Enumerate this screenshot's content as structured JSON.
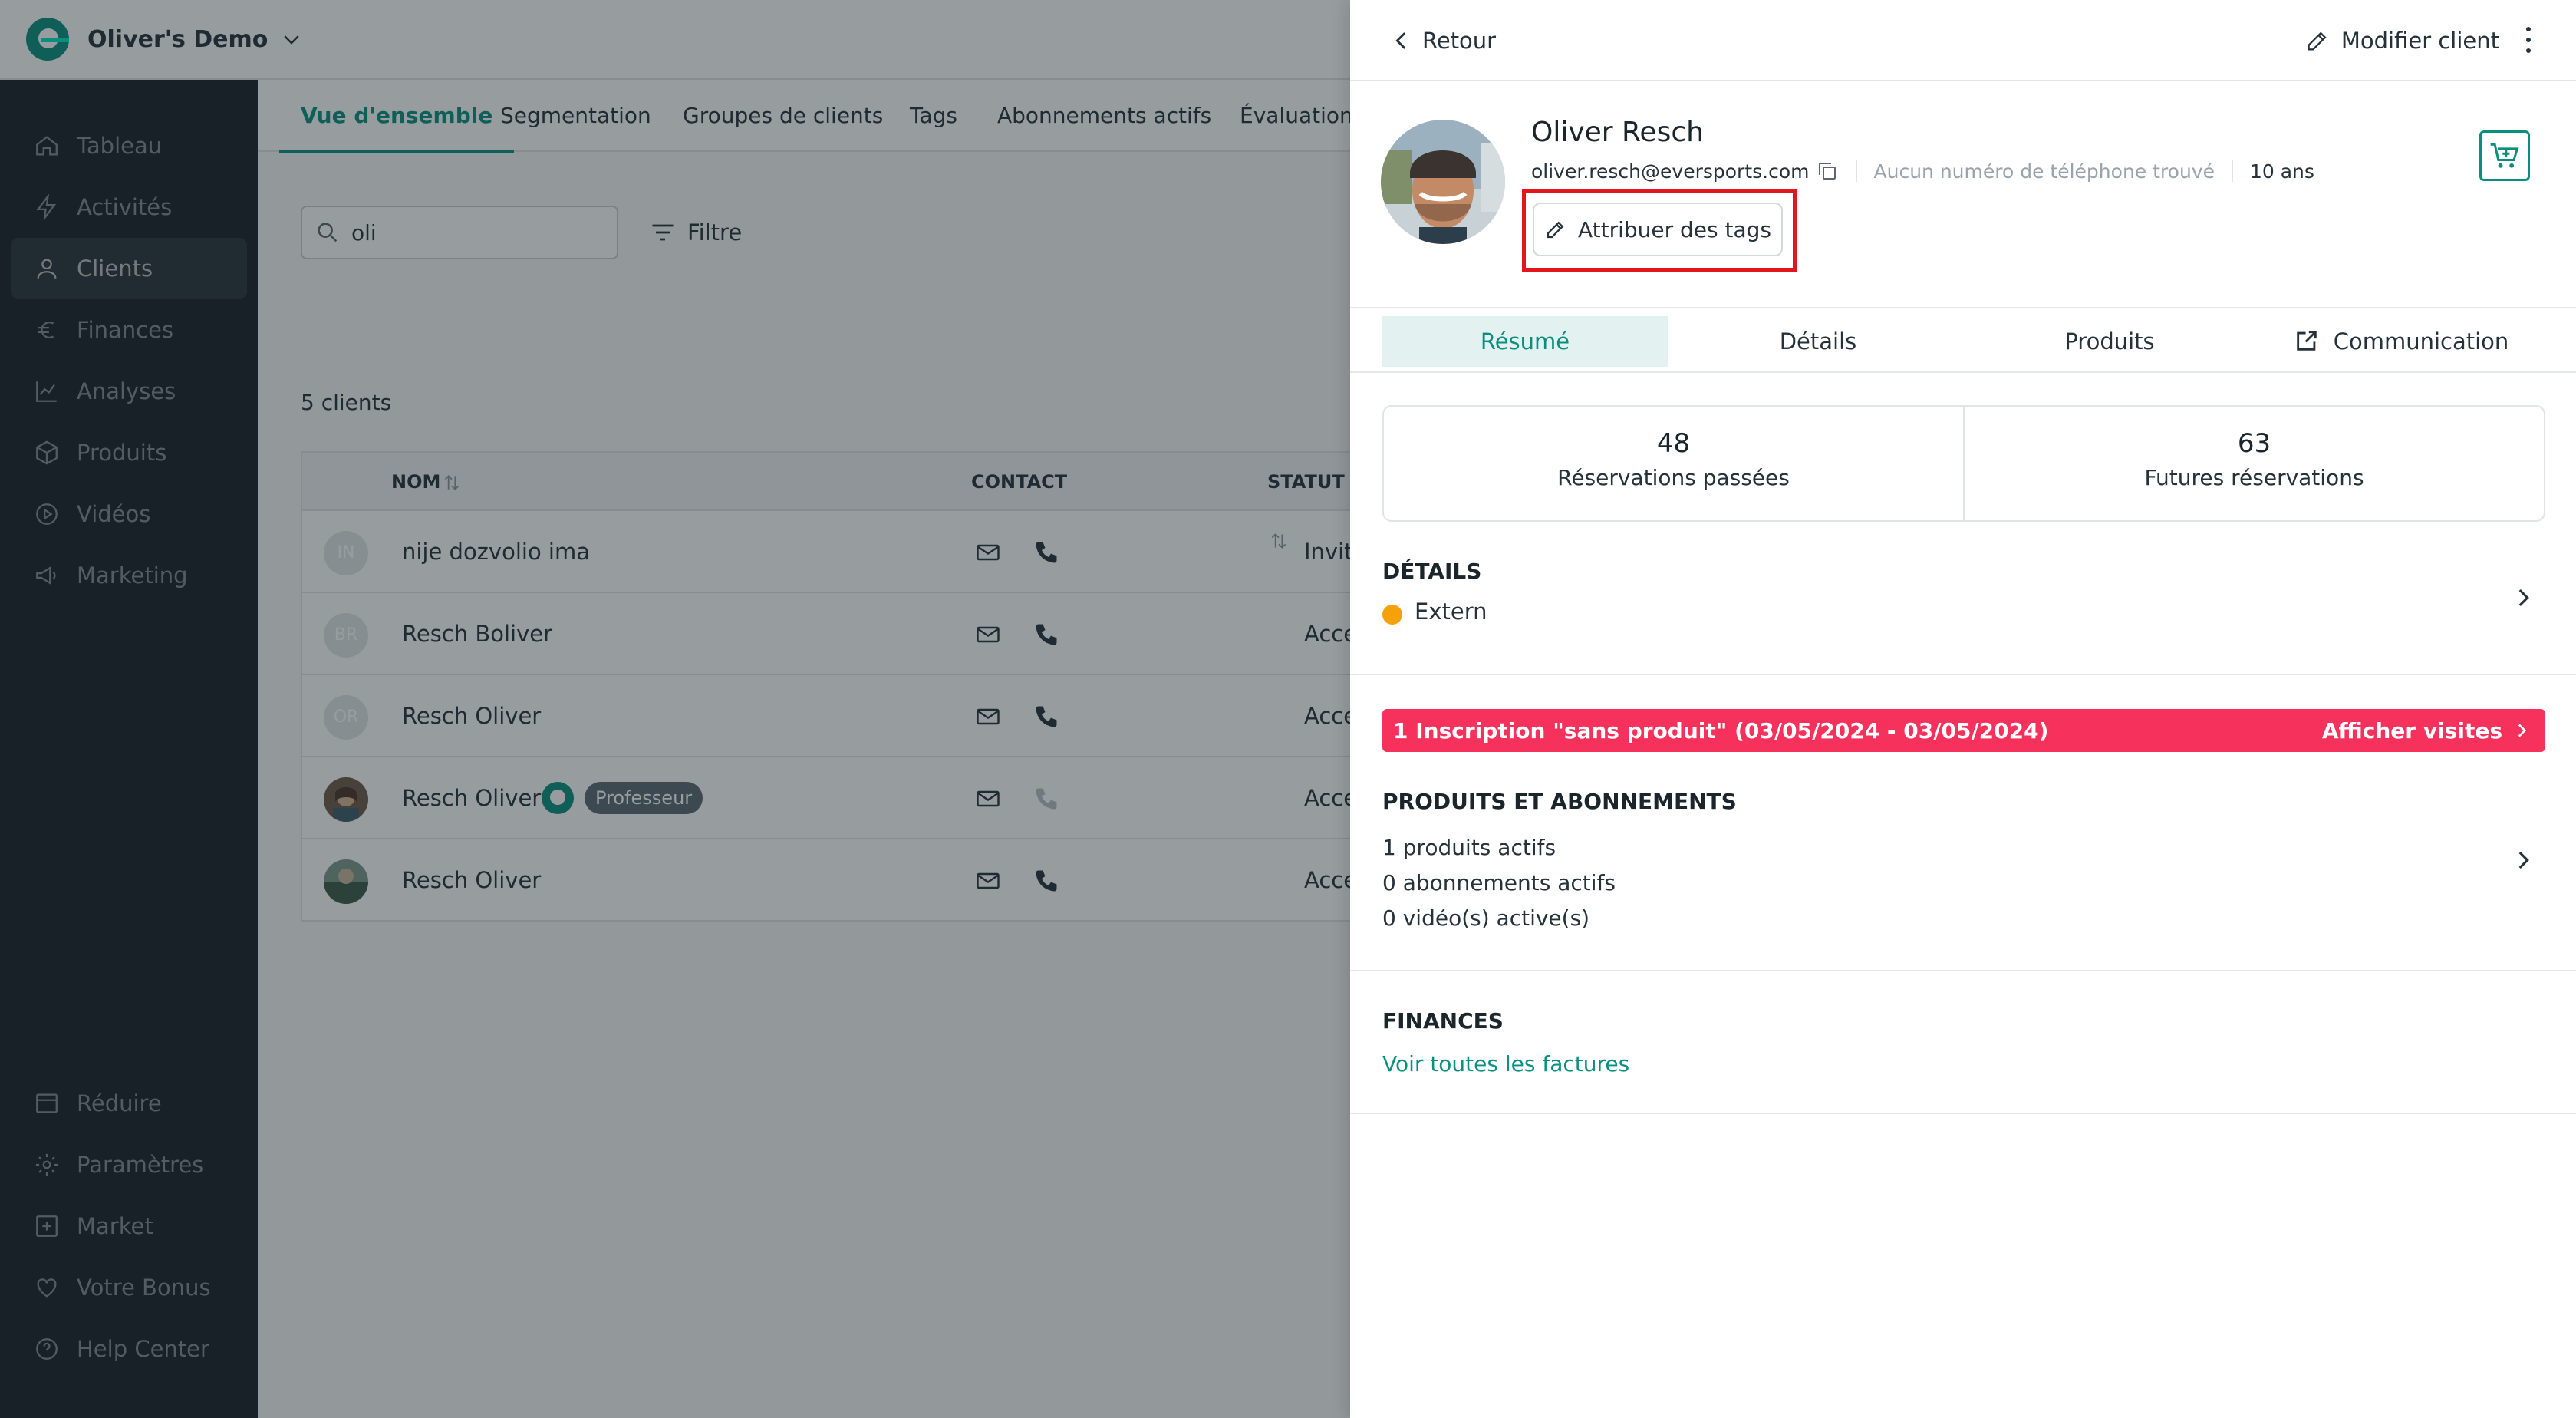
{
  "header": {
    "org_name": "Oliver's Demo"
  },
  "sidebar": {
    "items": [
      {
        "label": "Tableau"
      },
      {
        "label": "Activités"
      },
      {
        "label": "Clients"
      },
      {
        "label": "Finances"
      },
      {
        "label": "Analyses"
      },
      {
        "label": "Produits"
      },
      {
        "label": "Vidéos"
      },
      {
        "label": "Marketing"
      }
    ],
    "bottom_items": [
      {
        "label": "Réduire"
      },
      {
        "label": "Paramètres"
      },
      {
        "label": "Market"
      },
      {
        "label": "Votre Bonus"
      },
      {
        "label": "Help Center"
      }
    ]
  },
  "main": {
    "tabs": [
      {
        "label": "Vue d'ensemble"
      },
      {
        "label": "Segmentation"
      },
      {
        "label": "Groupes de clients"
      },
      {
        "label": "Tags"
      },
      {
        "label": "Abonnements actifs"
      },
      {
        "label": "Évaluations"
      }
    ],
    "search": {
      "value": "oli",
      "placeholder": ""
    },
    "filter_label": "Filtre",
    "count_label": "5 clients",
    "table": {
      "columns": {
        "name": "NOM",
        "contact": "CONTACT",
        "status": "STATUT"
      },
      "rows": [
        {
          "initials": "IN",
          "name": "nije dozvolio ima",
          "status": "Invité"
        },
        {
          "initials": "BR",
          "name": "Resch Boliver",
          "status": "Accepté"
        },
        {
          "initials": "OR",
          "name": "Resch Oliver",
          "status": "Accepté"
        },
        {
          "initials": "",
          "name": "Resch Oliver",
          "status": "Accepté",
          "badge": "Professeur"
        },
        {
          "initials": "",
          "name": "Resch Oliver",
          "status": "Accepté"
        }
      ]
    }
  },
  "panel": {
    "back_label": "Retour",
    "edit_label": "Modifier client",
    "client": {
      "name": "Oliver Resch",
      "email": "oliver.resch@eversports.com",
      "phone": "Aucun numéro de téléphone trouvé",
      "age": "10 ans"
    },
    "tags_button": "Attribuer des tags",
    "tabs": [
      {
        "label": "Résumé"
      },
      {
        "label": "Détails"
      },
      {
        "label": "Produits"
      },
      {
        "label": "Communication"
      }
    ],
    "stats": [
      {
        "value": "48",
        "label": "Réservations passées"
      },
      {
        "value": "63",
        "label": "Futures réservations"
      }
    ],
    "details": {
      "title": "DÉTAILS",
      "type_label": "Extern"
    },
    "alert": {
      "text": "1 Inscription \"sans produit\" (03/05/2024 - 03/05/2024)",
      "link": "Afficher visites"
    },
    "products": {
      "title": "PRODUITS ET ABONNEMENTS",
      "lines": [
        "1 produits actifs",
        "0 abonnements actifs",
        "0 vidéo(s) active(s)"
      ]
    },
    "finances": {
      "title": "FINANCES",
      "link": "Voir toutes les factures"
    }
  },
  "colors": {
    "brand": "#0a8f7f",
    "alert": "#f6315b",
    "highlight_box": "#e3161b",
    "extern_dot": "#f5a20a",
    "sidebar_bg": "#1f2b33"
  }
}
